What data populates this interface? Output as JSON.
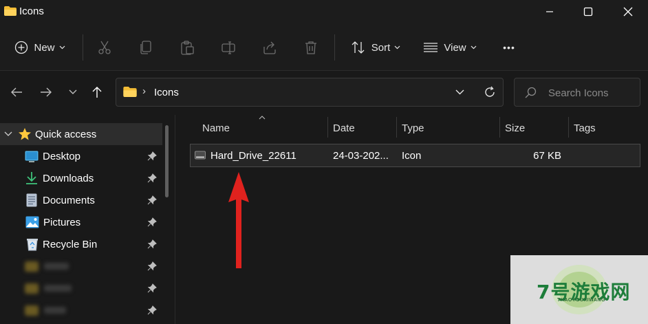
{
  "window": {
    "title": "Icons"
  },
  "toolbar": {
    "new_label": "New",
    "sort_label": "Sort",
    "view_label": "View",
    "more_label": "•••"
  },
  "address": {
    "separator": "›",
    "location": "Icons",
    "search_placeholder": "Search Icons"
  },
  "sidebar": {
    "quick_access": "Quick access",
    "items": [
      {
        "label": "Desktop",
        "icon": "desktop-icon"
      },
      {
        "label": "Downloads",
        "icon": "download-icon"
      },
      {
        "label": "Documents",
        "icon": "documents-icon"
      },
      {
        "label": "Pictures",
        "icon": "pictures-icon"
      },
      {
        "label": "Recycle Bin",
        "icon": "recycle-bin-icon"
      }
    ]
  },
  "columns": {
    "name": "Name",
    "date": "Date",
    "type": "Type",
    "size": "Size",
    "tags": "Tags"
  },
  "files": [
    {
      "name": "Hard_Drive_22611",
      "date": "24-03-202...",
      "type": "Icon",
      "size": "67 KB"
    }
  ],
  "watermark": {
    "main": "7号游戏网",
    "sub": "THAOYOUXIWANG"
  },
  "colors": {
    "accent": "#ffc83d",
    "arrow": "#e0221e",
    "background": "#191919"
  }
}
